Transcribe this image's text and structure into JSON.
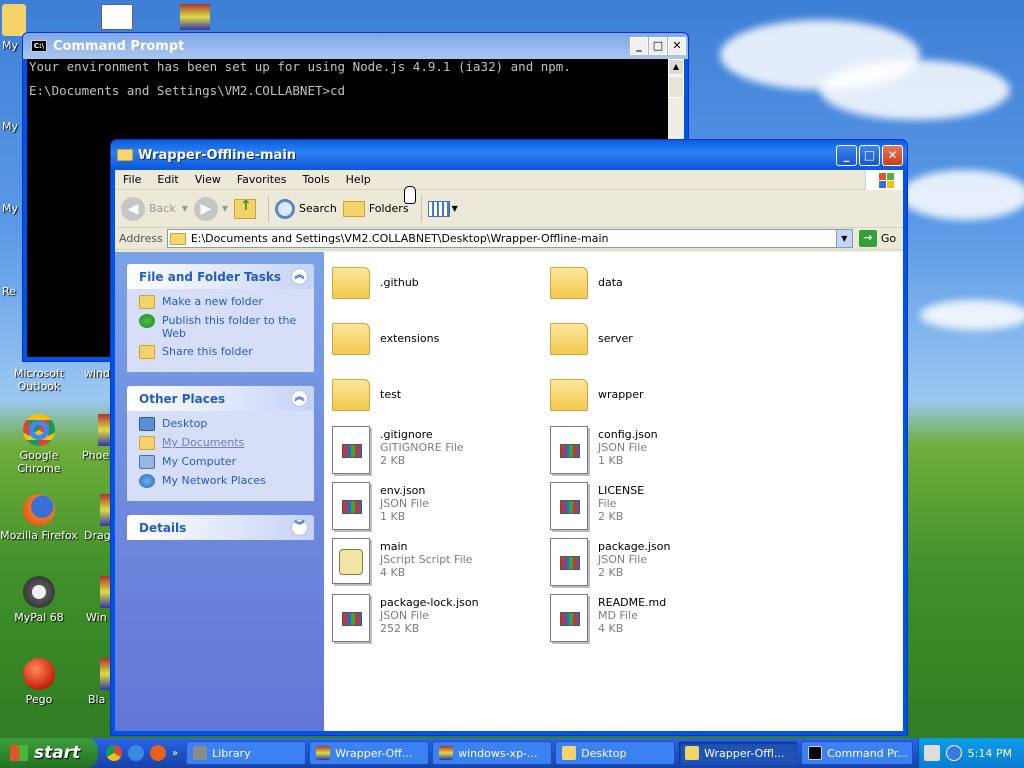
{
  "desktop": {
    "icons": [
      {
        "label": "My",
        "x": 0
      },
      {
        "label": "Microsoft Outlook"
      },
      {
        "label": "windo"
      },
      {
        "label": "Google Chrome"
      },
      {
        "label": "Phoen"
      },
      {
        "label": "Mozilla Firefox"
      },
      {
        "label": "Drag"
      },
      {
        "label": "MyPal 68"
      },
      {
        "label": "Win"
      },
      {
        "label": "Pego"
      },
      {
        "label": "Bla"
      },
      {
        "label": "My"
      },
      {
        "label": "My"
      },
      {
        "label": "Re"
      }
    ]
  },
  "cmd": {
    "title": "Command Prompt",
    "icon_text": "C:\\",
    "line1": "Your environment has been set up for using Node.js 4.9.1 (ia32) and npm.",
    "line2": "E:\\Documents and Settings\\VM2.COLLABNET>cd"
  },
  "explorer": {
    "title": "Wrapper-Offline-main",
    "menu": [
      "File",
      "Edit",
      "View",
      "Favorites",
      "Tools",
      "Help"
    ],
    "toolbar": {
      "back": "Back",
      "search": "Search",
      "folders": "Folders"
    },
    "address_label": "Address",
    "address_value": "E:\\Documents and Settings\\VM2.COLLABNET\\Desktop\\Wrapper-Offline-main",
    "go_label": "Go",
    "tasks": {
      "title": "File and Folder Tasks",
      "items": [
        "Make a new folder",
        "Publish this folder to the Web",
        "Share this folder"
      ]
    },
    "places": {
      "title": "Other Places",
      "items": [
        "Desktop",
        "My Documents",
        "My Computer",
        "My Network Places"
      ]
    },
    "details": {
      "title": "Details"
    },
    "files": [
      {
        "name": ".github",
        "type": "folder"
      },
      {
        "name": "data",
        "type": "folder"
      },
      {
        "name": "extensions",
        "type": "folder"
      },
      {
        "name": "server",
        "type": "folder"
      },
      {
        "name": "test",
        "type": "folder"
      },
      {
        "name": "wrapper",
        "type": "folder"
      },
      {
        "name": ".gitignore",
        "kind": "GITIGNORE File",
        "size": "2 KB"
      },
      {
        "name": "config.json",
        "kind": "JSON File",
        "size": "1 KB"
      },
      {
        "name": "env.json",
        "kind": "JSON File",
        "size": "1 KB"
      },
      {
        "name": "LICENSE",
        "kind": "File",
        "size": "2 KB"
      },
      {
        "name": "main",
        "kind": "JScript Script File",
        "size": "4 KB"
      },
      {
        "name": "package.json",
        "kind": "JSON File",
        "size": "2 KB"
      },
      {
        "name": "package-lock.json",
        "kind": "JSON File",
        "size": "252 KB"
      },
      {
        "name": "README.md",
        "kind": "MD File",
        "size": "4 KB"
      }
    ]
  },
  "taskbar": {
    "start": "start",
    "tasks": [
      "Library",
      "Wrapper-Off...",
      "windows-xp-...",
      "Desktop",
      "Wrapper-Offl...",
      "Command Pr..."
    ],
    "clock": "5:14 PM"
  }
}
